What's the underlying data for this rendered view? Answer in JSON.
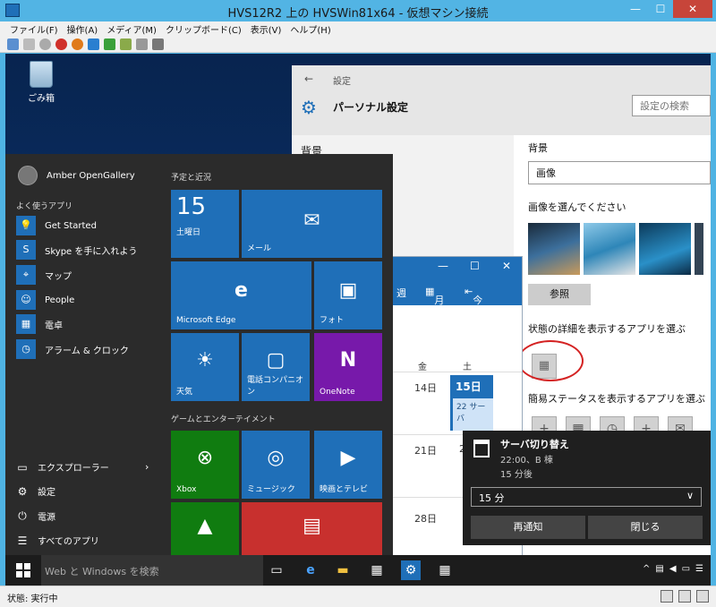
{
  "host": {
    "title": "HVS12R2 上の HVSWin81x64 - 仮想マシン接続",
    "win_buttons": [
      "—",
      "☐",
      "✕"
    ],
    "menu": [
      "ファイル(F)",
      "操作(A)",
      "メディア(M)",
      "クリップボード(C)",
      "表示(V)",
      "ヘルプ(H)"
    ],
    "status": "状態: 実行中"
  },
  "desktop": {
    "recycle_bin": "ごみ箱"
  },
  "settings": {
    "back": "←",
    "breadcrumb": "設定",
    "page_title": "パーソナル設定",
    "search_placeholder": "設定の検索",
    "left_category": "背景",
    "background_label": "背景",
    "background_value": "画像",
    "choose_picture_label": "画像を選んでください",
    "browse_button": "参照",
    "detailed_status_label": "状態の詳細を表示するアプリを選ぶ",
    "quick_status_label": "簡易ステータスを表示するアプリを選ぶ"
  },
  "calendar": {
    "controls": [
      "—",
      "☐",
      "✕"
    ],
    "views": [
      "週",
      "月",
      "今日"
    ],
    "days_of_week": [
      "金",
      "土"
    ],
    "dates": [
      "14日",
      "21日",
      "28日",
      "2"
    ],
    "today": "15日",
    "today_event": "22 サーバ"
  },
  "toast": {
    "title": "サーバ切り替え",
    "line1": "22:00、B 棟",
    "line2": "15 分後",
    "snooze_value": "15 分",
    "snooze_button": "再通知",
    "dismiss_button": "閉じる"
  },
  "start": {
    "user": "Amber OpenGallery",
    "most_used_label": "よく使うアプリ",
    "apps": [
      "Get Started",
      "Skype を手に入れよう",
      "マップ",
      "People",
      "電卓",
      "アラーム & クロック"
    ],
    "system": [
      "エクスプローラー",
      "設定",
      "電源",
      "すべてのアプリ"
    ],
    "group1": "予定と近況",
    "group2": "ゲームとエンターテイメント",
    "tiles": {
      "calendar_day": "15",
      "calendar_weekday": "土曜日",
      "mail": "メール",
      "edge": "Microsoft Edge",
      "photos": "フォト",
      "weather": "天気",
      "phone": "電話コンパニオン",
      "onenote": "OneNote",
      "xbox": "Xbox",
      "music": "ミュージック",
      "movies": "映画とテレビ"
    }
  },
  "taskbar": {
    "search_placeholder": "Web と Windows を検索"
  },
  "colors": {
    "accent": "#1f6fb8",
    "start_bg": "#2b2b2b",
    "xbox": "#107c10",
    "onenote": "#7719aa",
    "news": "#c8302e",
    "highlight_circle": "#d42222"
  }
}
